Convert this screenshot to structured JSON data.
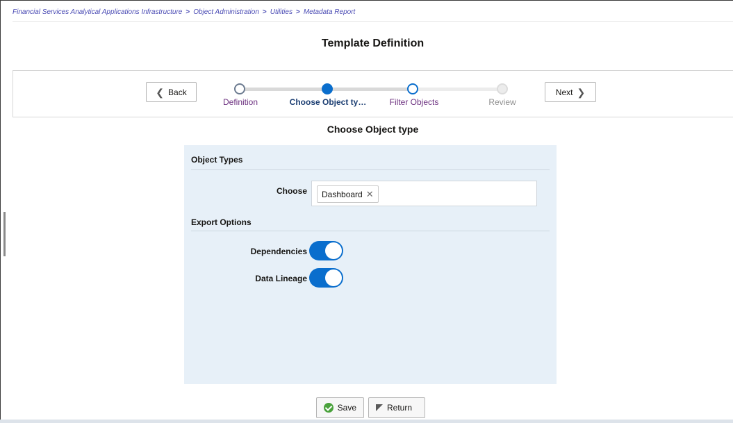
{
  "breadcrumb": {
    "items": [
      "Financial Services Analytical Applications Infrastructure",
      "Object Administration",
      "Utilities",
      "Metadata Report"
    ],
    "separator": ">"
  },
  "page_title": "Template Definition",
  "train": {
    "back_label": "Back",
    "next_label": "Next",
    "stops": [
      {
        "label": "Definition",
        "state": "visited"
      },
      {
        "label": "Choose Object ty…",
        "state": "current"
      },
      {
        "label": "Filter Objects",
        "state": "next"
      },
      {
        "label": "Review",
        "state": "disabled"
      }
    ]
  },
  "section_title": "Choose Object type",
  "object_types": {
    "heading": "Object Types",
    "choose_label": "Choose",
    "selected": [
      "Dashboard"
    ],
    "remove_icon": "close-icon"
  },
  "export_options": {
    "heading": "Export Options",
    "dependencies_label": "Dependencies",
    "dependencies_on": true,
    "data_lineage_label": "Data Lineage",
    "data_lineage_on": true
  },
  "footer": {
    "save_label": "Save",
    "return_label": "Return"
  },
  "colors": {
    "accent": "#0a6ecd",
    "panel_bg": "#e7f0f8",
    "link": "#4a4bb4",
    "visited_label": "#6b2f7f",
    "save_icon": "#4aa23c"
  }
}
